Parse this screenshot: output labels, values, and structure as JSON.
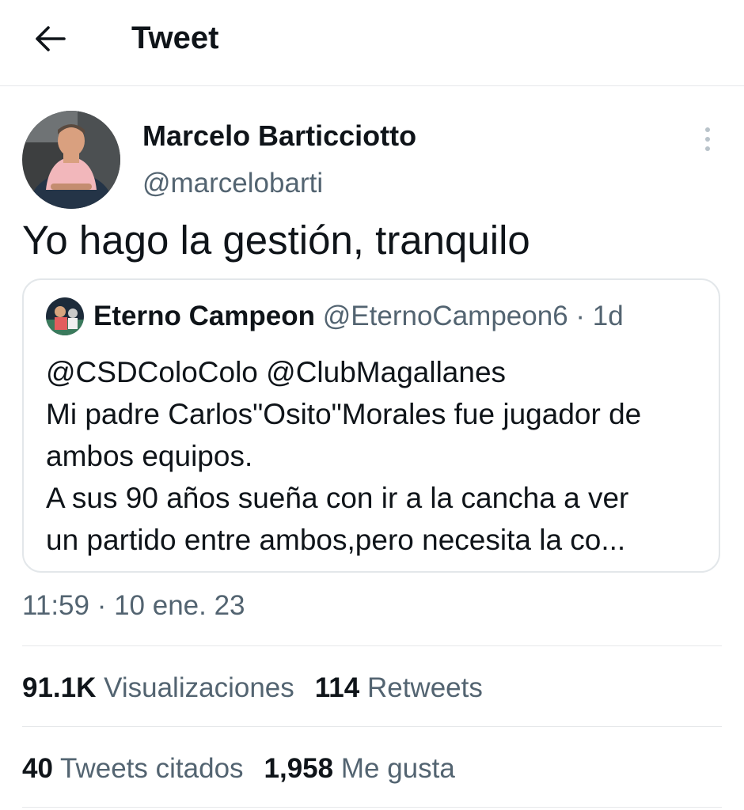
{
  "header": {
    "title": "Tweet"
  },
  "tweet": {
    "author_name": "Marcelo Barticciotto",
    "author_handle": "@marcelobarti",
    "text": "Yo hago la gestión, tranquilo",
    "timestamp": "11:59 · 10 ene. 23"
  },
  "quoted": {
    "author_name": "Eterno Campeon",
    "author_handle": "@EternoCampeon6",
    "age": "· 1d",
    "lines": [
      "@CSDColoColo @ClubMagallanes",
      "Mi padre Carlos\"Osito\"Morales fue jugador de",
      "ambos equipos.",
      "A sus 90 años sueña con ir a la cancha a ver",
      "un partido entre ambos,pero necesita la co..."
    ]
  },
  "stats": {
    "views_count": "91.1K",
    "views_label": "Visualizaciones",
    "retweets_count": "114",
    "retweets_label": "Retweets",
    "quotes_count": "40",
    "quotes_label": "Tweets citados",
    "likes_count": "1,958",
    "likes_label": "Me gusta"
  },
  "icons": {
    "back": "arrow-left-icon",
    "more": "more-vertical-icon"
  },
  "colors": {
    "text_primary": "#0f1419",
    "text_secondary": "#536471",
    "border": "#e6e8ea"
  }
}
